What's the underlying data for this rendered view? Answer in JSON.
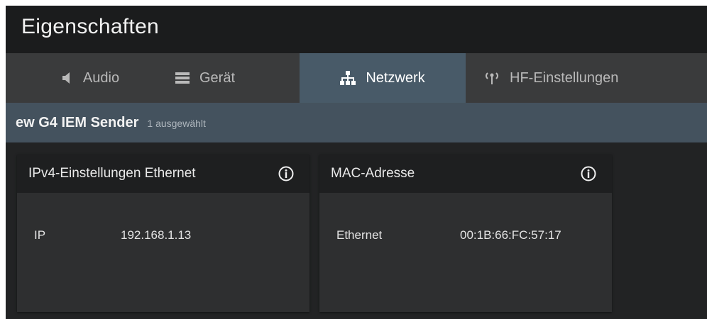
{
  "window": {
    "title": "Eigenschaften"
  },
  "tabs": [
    {
      "label": "Audio",
      "icon": "speaker-icon"
    },
    {
      "label": "Gerät",
      "icon": "device-icon"
    },
    {
      "label": "Netzwerk",
      "icon": "network-icon",
      "active": true
    },
    {
      "label": "HF-Einstellungen",
      "icon": "antenna-icon"
    }
  ],
  "subheader": {
    "device": "ew G4 IEM Sender",
    "selection": "1 ausgewählt"
  },
  "cards": {
    "ipv4": {
      "title": "IPv4-Einstellungen Ethernet",
      "row_label": "IP",
      "row_value": "192.168.1.13"
    },
    "mac": {
      "title": "MAC-Adresse",
      "row_label": "Ethernet",
      "row_value": "00:1B:66:FC:57:17"
    }
  },
  "colors": {
    "accent": "#485a68",
    "header_bar": "#44525e",
    "background": "#222324"
  }
}
